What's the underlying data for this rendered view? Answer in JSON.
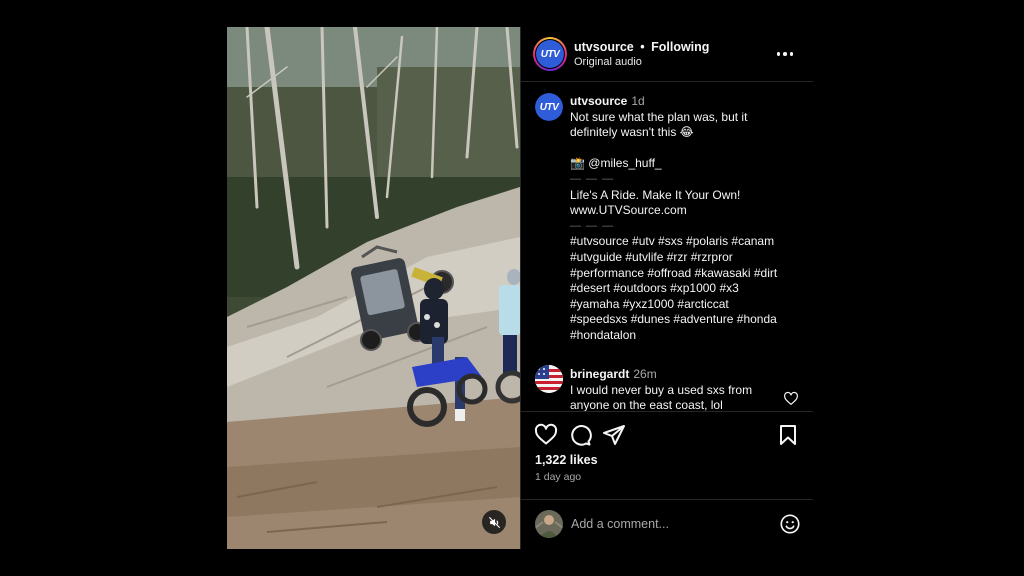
{
  "post": {
    "author": "utvsource",
    "follow_status": "Following",
    "separator": "•",
    "audio": "Original audio",
    "avatar_text": "UTV"
  },
  "caption": {
    "username": "utvsource",
    "time": "1d",
    "lines": [
      "Not sure what the plan was, but it",
      "definitely wasn't this 😂",
      "",
      "📸 @miles_huff_",
      "— — —",
      "Life's A Ride. Make It Your Own!",
      "www.UTVSource.com",
      "— — —",
      "#utvsource #utv #sxs #polaris #canam",
      "#utvguide #utvlife #rzr #rzrpror",
      "#performance #offroad #kawasaki #dirt",
      "#desert #outdoors #xp1000 #x3",
      "#yamaha #yxz1000 #arcticcat",
      "#speedsxs #dunes #adventure #honda",
      "#hondatalon"
    ]
  },
  "comment": {
    "username": "brinegardt",
    "time": "26m",
    "lines": [
      "I would never buy a used sxs from",
      "anyone on the east coast, lol"
    ]
  },
  "stats": {
    "likes": "1,322 likes",
    "posted": "1 day ago"
  },
  "composer": {
    "placeholder": "Add a comment..."
  },
  "icons": {
    "mute": "speaker-muted-icon",
    "more": "more-horizontal-icon",
    "like": "heart-outline-icon",
    "comment": "comment-bubble-icon",
    "share": "paper-plane-icon",
    "save": "bookmark-outline-icon",
    "emoji": "smiley-icon"
  },
  "colors": {
    "background": "#000000",
    "panel": "#000000",
    "divider": "#262626",
    "text": "#f5f5f5",
    "muted": "#a8a8a8",
    "utv_blue": "#2f5cd8"
  }
}
